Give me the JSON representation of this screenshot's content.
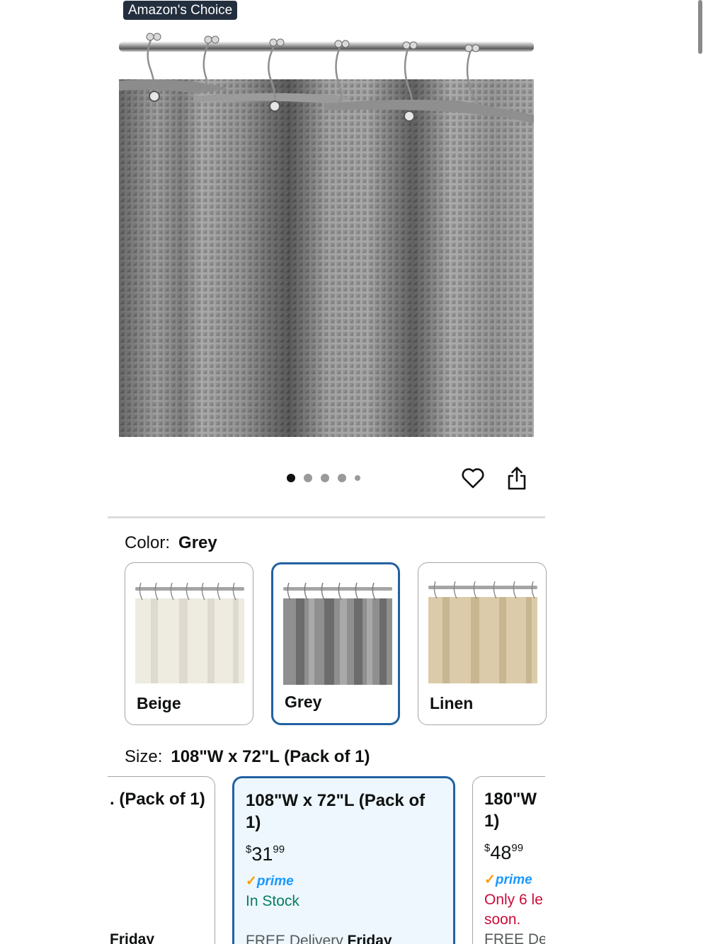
{
  "badge": "Amazon's Choice",
  "gallery": {
    "image_count": 5,
    "active_index": 0
  },
  "icons": {
    "wishlist": "heart-icon",
    "share": "share-icon"
  },
  "colors": {
    "selected_border": "#2162a1",
    "selected_bg": "#edf7fd",
    "prime": "#1a98ff",
    "in_stock": "#067d62",
    "low_stock": "#cc0c39",
    "badge_bg": "#232f3e"
  },
  "color_selector": {
    "label": "Color:",
    "selected": "Grey",
    "options": [
      {
        "name": "Beige"
      },
      {
        "name": "Grey"
      },
      {
        "name": "Linen"
      }
    ]
  },
  "size_selector": {
    "label": "Size:",
    "selected": "108\"W x 72\"L (Pack of 1)",
    "options": [
      {
        "title_partial": ". (Pack of 1)",
        "delivery_day": "Friday"
      },
      {
        "title_line1": "108\"W x 72\"L (Pack of",
        "title_line2": "1)",
        "price_symbol": "$",
        "price_whole": "31",
        "price_fraction": "99",
        "prime": "prime",
        "stock": "In Stock",
        "delivery_prefix": "FREE Delivery",
        "delivery_day": "Friday"
      },
      {
        "title_line1": "180\"W",
        "title_line2": "1)",
        "price_symbol": "$",
        "price_whole": "48",
        "price_fraction": "99",
        "prime": "prime",
        "stock_line1": "Only 6 le",
        "stock_line2": "soon.",
        "delivery_partial": "FREE Del"
      }
    ]
  }
}
